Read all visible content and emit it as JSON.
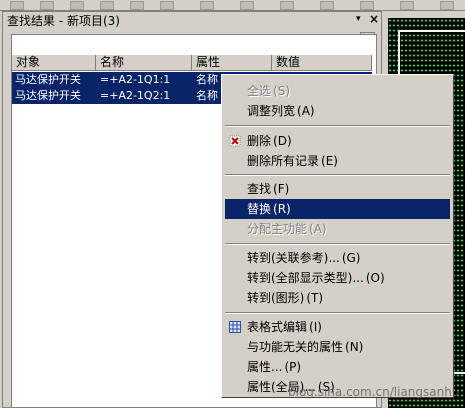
{
  "panel": {
    "title": "查找结果 - 新项目(3)",
    "pin_glyph": "▾",
    "close_glyph": "×",
    "arrow_glyph": "▶",
    "columns": [
      "对象",
      "名称",
      "属性",
      "数值"
    ],
    "rows": [
      {
        "object": "马达保护开关",
        "name": "=+A2-1Q1:1",
        "property": "名称",
        "value": ""
      },
      {
        "object": "马达保护开关",
        "name": "=+A2-1Q2:1",
        "property": "名称",
        "value": ""
      }
    ]
  },
  "context_menu": {
    "items": [
      {
        "label": "全选",
        "accel": "(S)",
        "disabled": true
      },
      {
        "label": "调整列宽",
        "accel": "(A)"
      },
      {
        "sep": true
      },
      {
        "label": "删除",
        "accel": "(D)",
        "icon": "delete-icon"
      },
      {
        "label": "删除所有记录",
        "accel": "(E)"
      },
      {
        "sep": true
      },
      {
        "label": "查找",
        "accel": "(F)"
      },
      {
        "label": "替换",
        "accel": "(R)",
        "highlighted": true
      },
      {
        "label": "分配主功能",
        "accel": "(A)",
        "disabled": true
      },
      {
        "sep": true
      },
      {
        "label": "转到(关联参考)...",
        "accel": "(G)"
      },
      {
        "label": "转到(全部显示类型)...",
        "accel": "(O)"
      },
      {
        "label": "转到(图形)",
        "accel": "(T)"
      },
      {
        "sep": true
      },
      {
        "label": "表格式编辑",
        "accel": "(I)",
        "icon": "table-icon"
      },
      {
        "label": "与功能无关的属性",
        "accel": "(N)"
      },
      {
        "label": "属性...",
        "accel": "(P)"
      },
      {
        "label": "属性(全局)...",
        "accel": "(S)"
      }
    ]
  },
  "watermark": "blog.sina.com.cn/liangsanhu",
  "colors": {
    "highlight": "#0a246a",
    "face": "#d4d0c8",
    "canvas_bg": "#000000",
    "canvas_grid": "#2ee83a"
  }
}
